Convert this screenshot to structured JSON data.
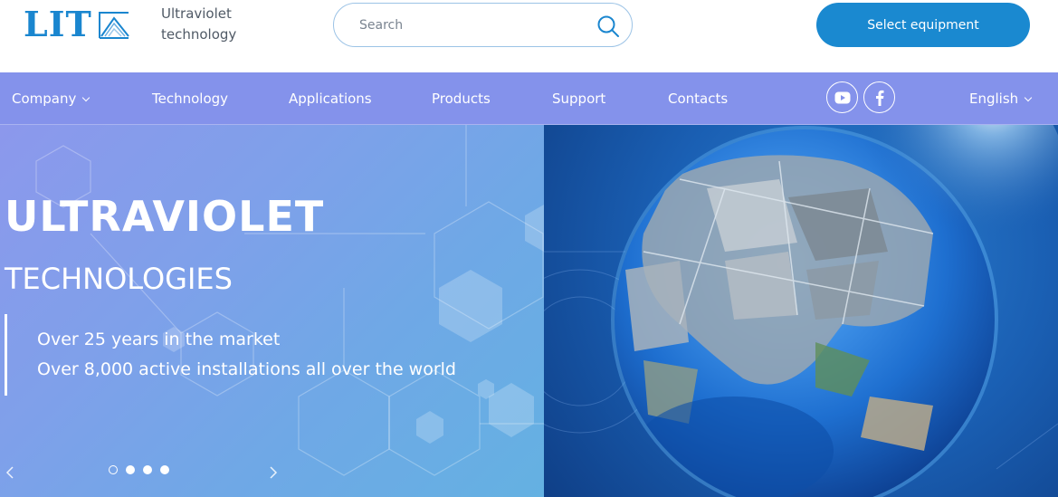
{
  "header": {
    "logo_text": "LIT",
    "tagline_line1": "Ultraviolet",
    "tagline_line2": "technology",
    "search_placeholder": "Search",
    "select_button": "Select equipment"
  },
  "nav": {
    "items": [
      {
        "label": "Company",
        "has_dropdown": true
      },
      {
        "label": "Technology"
      },
      {
        "label": "Applications"
      },
      {
        "label": "Products"
      },
      {
        "label": "Support"
      },
      {
        "label": "Contacts"
      }
    ],
    "social": [
      "youtube-icon",
      "facebook-icon"
    ],
    "language": "English"
  },
  "hero": {
    "title": "ULTRAVIOLET",
    "subtitle": "TECHNOLOGIES",
    "line1": "Over 25 years in the market",
    "line2": "Over 8,000 active installations all over the world",
    "slides": 4,
    "active_slide": 1
  },
  "colors": {
    "brand_blue": "#1a86cf",
    "nav_bg": "#8492eb",
    "button_bg": "#1a89d0"
  }
}
